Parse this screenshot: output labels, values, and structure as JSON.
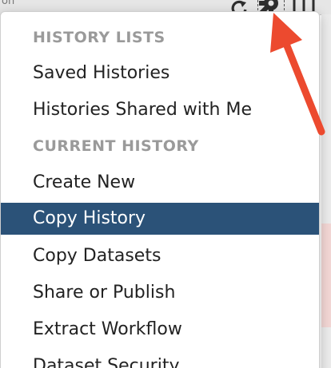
{
  "toolbar": {
    "fragment_text": "on",
    "refresh_icon": "refresh-icon",
    "gear_icon": "gear-icon",
    "columns_icon": "columns-icon"
  },
  "menu": {
    "history_lists_header": "HISTORY LISTS",
    "saved_histories": "Saved Histories",
    "histories_shared": "Histories Shared with Me",
    "current_history_header": "CURRENT HISTORY",
    "create_new": "Create New",
    "copy_history": "Copy History",
    "copy_datasets": "Copy Datasets",
    "share_or_publish": "Share or Publish",
    "extract_workflow": "Extract Workflow",
    "dataset_security": "Dataset Security"
  },
  "colors": {
    "active_item_bg": "#2b5278",
    "header_text": "#9a9a9a",
    "annotation_arrow": "#ec4a2f"
  }
}
